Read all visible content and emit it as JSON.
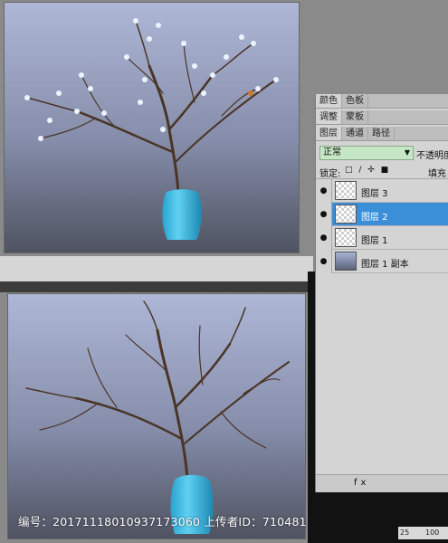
{
  "panel": {
    "tabs_row1": [
      "颜色",
      "色板"
    ],
    "tabs_row2": [
      "调整",
      "蒙板"
    ],
    "tabs_row3": [
      "图层",
      "通道",
      "路径"
    ],
    "blend_mode": "正常",
    "opacity_label": "不透明度:",
    "lock_label": "锁定:",
    "fill_label": "填充",
    "layers": [
      {
        "name": "图层 3",
        "selected": false
      },
      {
        "name": "图层 2",
        "selected": true
      },
      {
        "name": "图层 1",
        "selected": false
      },
      {
        "name": "图层 1 副本",
        "selected": false
      }
    ],
    "footer_icons": "fx"
  },
  "ruler": {
    "ticks": [
      "25",
      "100"
    ]
  },
  "watermark": "编号：20171118010937173060 上传者ID：710481",
  "colors": {
    "selection": "#3b8fd8",
    "vase": "#3fb6e0",
    "blend_field": "#c6e7c6"
  }
}
